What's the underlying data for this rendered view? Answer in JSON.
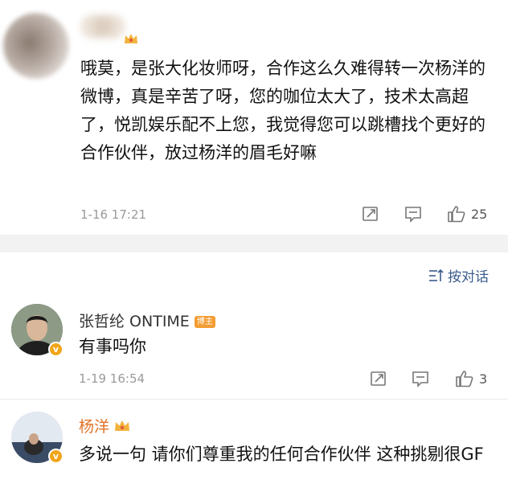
{
  "comments": [
    {
      "username": "",
      "text": "哦莫，是张大化妆师呀，合作这么久难得转一次杨洋的微博，真是辛苦了呀，您的咖位太大了，技术太高超了，悦凯娱乐配不上您，我觉得您可以跳槽找个更好的合作伙伴，放过杨洋的眉毛好嘛",
      "time": "1-16 17:21",
      "likes": "25"
    },
    {
      "username": "张哲纶 ONTIME",
      "badge": "博主",
      "text": "有事吗你",
      "time": "1-19 16:54",
      "likes": "3"
    },
    {
      "username": "杨洋",
      "text": "多说一句 请你们尊重我的任何合作伙伴 这种挑剔很GF"
    }
  ],
  "dialog_link": "按对话",
  "colors": {
    "link_blue": "#3b5d8c",
    "orange_name": "#e2742a",
    "verified_badge": "#f2a51a",
    "separator": "#f2f2f2"
  },
  "icons": [
    "repost-icon",
    "comment-icon",
    "like-icon",
    "dialog-icon",
    "crown-icon",
    "verified-icon"
  ]
}
